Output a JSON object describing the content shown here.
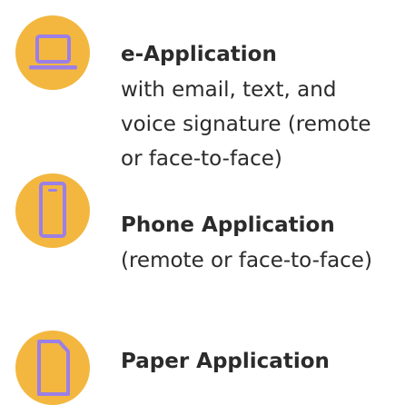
{
  "brand": {
    "circle_color": "#F3B73F",
    "icon_color": "#9B7FE6",
    "text_color": "#2b2b2b"
  },
  "options": [
    {
      "icon": "laptop-icon",
      "title": "e-Application",
      "description_lines": [
        "with email, text, and",
        "voice signature (remote",
        "or face-to-face)"
      ]
    },
    {
      "icon": "phone-icon",
      "title": "Phone Application",
      "description_lines": [
        "(remote or face-to-face)"
      ]
    },
    {
      "icon": "document-icon",
      "title": "Paper Application",
      "description_lines": []
    }
  ]
}
